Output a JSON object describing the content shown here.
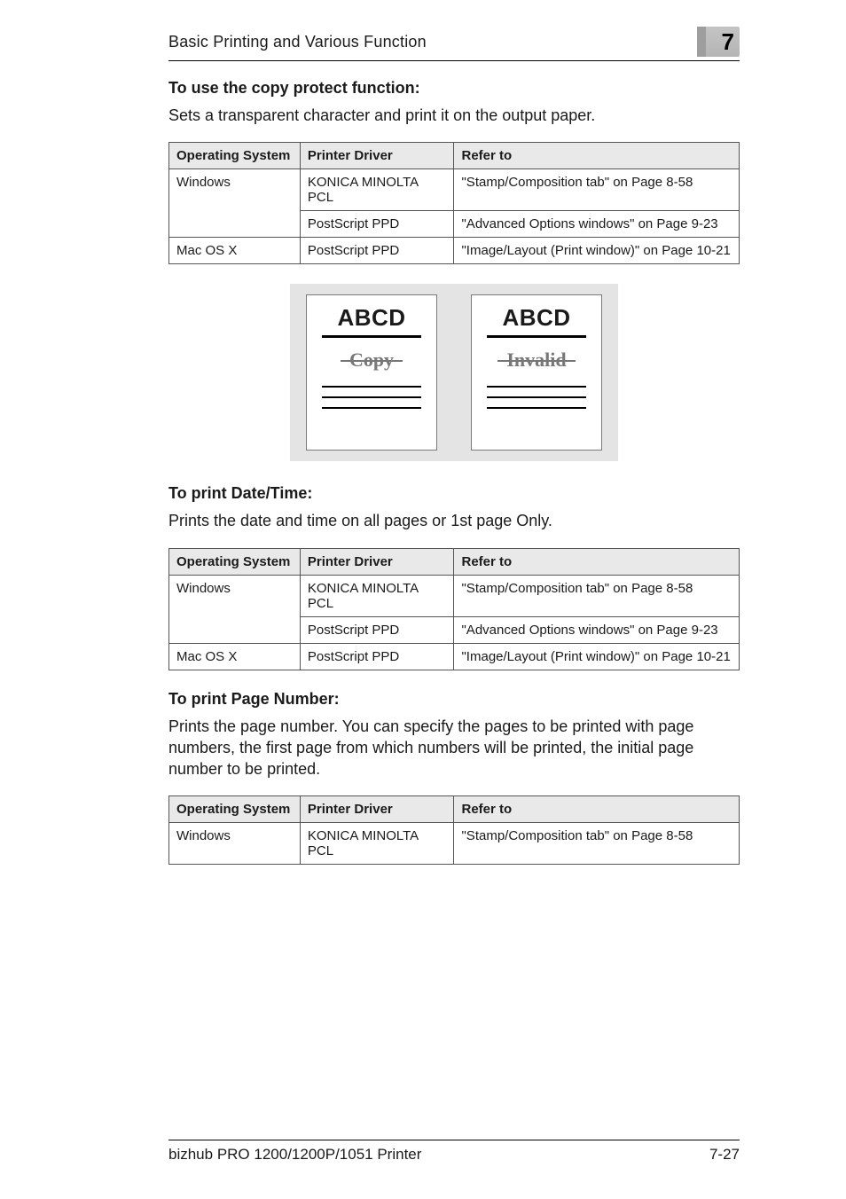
{
  "header": {
    "running_head": "Basic Printing and Various Function",
    "chapter_number": "7"
  },
  "section1": {
    "title": "To use the copy protect function:",
    "body": "Sets a transparent character and print it on the output paper."
  },
  "table1": {
    "headers": {
      "os": "Operating System",
      "driver": "Printer Driver",
      "ref": "Refer to"
    },
    "rows": [
      {
        "os": "Windows",
        "driver": "KONICA MINOLTA PCL",
        "ref": "\"Stamp/Composition tab\" on Page 8-58"
      },
      {
        "os": "",
        "driver": "PostScript PPD",
        "ref": "\"Advanced Options windows\" on Page 9-23"
      },
      {
        "os": "Mac OS X",
        "driver": "PostScript PPD",
        "ref": "\"Image/Layout (Print window)\" on Page 10-21"
      }
    ]
  },
  "illustration": {
    "title_left": "ABCD",
    "watermark_left": "Copy",
    "title_right": "ABCD",
    "watermark_right": "Invalid"
  },
  "section2": {
    "title": "To print Date/Time:",
    "body": "Prints the date and time on all pages or 1st page Only."
  },
  "table2": {
    "headers": {
      "os": "Operating System",
      "driver": "Printer Driver",
      "ref": "Refer to"
    },
    "rows": [
      {
        "os": "Windows",
        "driver": "KONICA MINOLTA PCL",
        "ref": "\"Stamp/Composition tab\" on Page 8-58"
      },
      {
        "os": "",
        "driver": "PostScript PPD",
        "ref": "\"Advanced Options windows\" on Page 9-23"
      },
      {
        "os": "Mac OS X",
        "driver": "PostScript PPD",
        "ref": "\"Image/Layout (Print window)\" on Page 10-21"
      }
    ]
  },
  "section3": {
    "title": "To print Page Number:",
    "body": "Prints the page number. You can specify the pages to be printed with page numbers, the first page from which numbers will be printed, the initial page number to be printed."
  },
  "table3": {
    "headers": {
      "os": "Operating System",
      "driver": "Printer Driver",
      "ref": "Refer to"
    },
    "rows": [
      {
        "os": "Windows",
        "driver": "KONICA MINOLTA PCL",
        "ref": "\"Stamp/Composition tab\" on Page 8-58"
      }
    ]
  },
  "footer": {
    "left": "bizhub PRO 1200/1200P/1051 Printer",
    "right": "7-27"
  }
}
